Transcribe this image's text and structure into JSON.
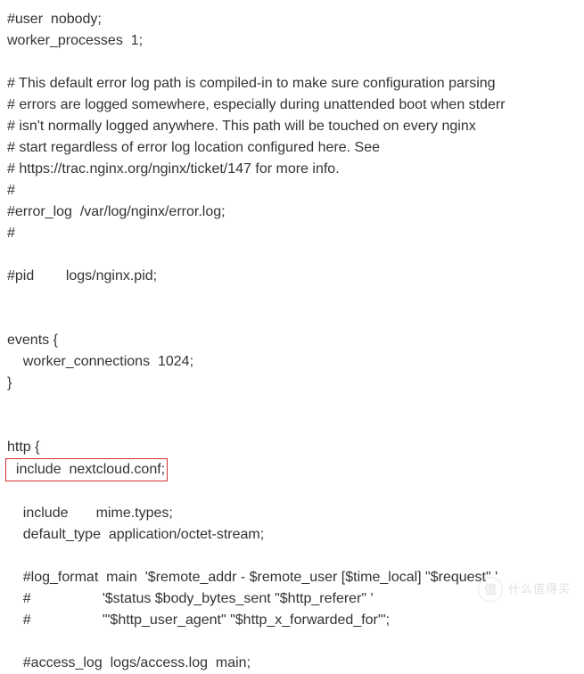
{
  "lines": {
    "l1": "#user  nobody;",
    "l2": "worker_processes  1;",
    "l3": "",
    "l4": "# This default error log path is compiled-in to make sure configuration parsing",
    "l5": "# errors are logged somewhere, especially during unattended boot when stderr",
    "l6": "# isn't normally logged anywhere. This path will be touched on every nginx",
    "l7": "# start regardless of error log location configured here. See",
    "l8": "# https://trac.nginx.org/nginx/ticket/147 for more info.",
    "l9": "#",
    "l10": "#error_log  /var/log/nginx/error.log;",
    "l11": "#",
    "l12": "",
    "l13": "#pid        logs/nginx.pid;",
    "l14": "",
    "l15": "",
    "l16": "events {",
    "l17": "    worker_connections  1024;",
    "l18": "}",
    "l19": "",
    "l20": "",
    "l21": "http {",
    "l22_highlight": "  include  nextcloud.conf;",
    "l23": "",
    "l24": "    include       mime.types;",
    "l25": "    default_type  application/octet-stream;",
    "l26": "",
    "l27": "    #log_format  main  '$remote_addr - $remote_user [$time_local] \"$request\" '",
    "l28": "    #                  '$status $body_bytes_sent \"$http_referer\" '",
    "l29": "    #                  '\"$http_user_agent\" \"$http_x_forwarded_for\"';",
    "l30": "",
    "l31": "    #access_log  logs/access.log  main;"
  },
  "watermark": {
    "symbol": "值",
    "text": "什么值得买"
  }
}
